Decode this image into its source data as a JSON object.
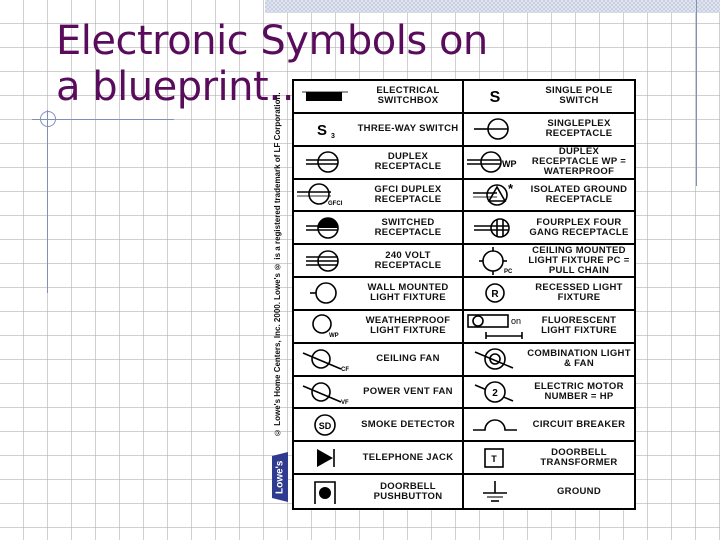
{
  "slide": {
    "title": "Electronic Symbols on a blueprint….",
    "copyright": "© Lowe's Home Centers, Inc. 2000. Lowe's ® is a registered trademark of LF Corporation.",
    "logo_text": "Lowe's",
    "colors": {
      "title": "#5a0c5c",
      "accent_line": "#8090b8",
      "logo": "#2e3b8f"
    }
  },
  "table": {
    "rows": [
      {
        "left": {
          "icon": "electrical-switchbox-icon",
          "label": "ELECTRICAL SWITCHBOX"
        },
        "right": {
          "icon": "single-pole-switch-icon",
          "symbol_text": "S",
          "label": "SINGLE POLE SWITCH"
        }
      },
      {
        "left": {
          "icon": "three-way-switch-icon",
          "symbol_text": "S",
          "symbol_sub": "3",
          "label": "THREE-WAY SWITCH"
        },
        "right": {
          "icon": "singleplex-receptacle-icon",
          "label": "SINGLEPLEX RECEPTACLE"
        }
      },
      {
        "left": {
          "icon": "duplex-receptacle-icon",
          "label": "DUPLEX RECEPTACLE"
        },
        "right": {
          "icon": "duplex-receptacle-waterproof-icon",
          "symbol_text": "WP",
          "label": "DUPLEX RECEPTACLE WP = WATERPROOF"
        }
      },
      {
        "left": {
          "icon": "gfci-duplex-receptacle-icon",
          "symbol_text": "GFCI",
          "label": "GFCI DUPLEX RECEPTACLE"
        },
        "right": {
          "icon": "isolated-ground-receptacle-icon",
          "symbol_text": "*",
          "label": "ISOLATED GROUND RECEPTACLE"
        }
      },
      {
        "left": {
          "icon": "switched-receptacle-icon",
          "label": "SWITCHED RECEPTACLE"
        },
        "right": {
          "icon": "fourplex-receptacle-icon",
          "label": "FOURPLEX FOUR GANG RECEPTACLE"
        }
      },
      {
        "left": {
          "icon": "240-volt-receptacle-icon",
          "label": "240 VOLT RECEPTACLE"
        },
        "right": {
          "icon": "ceiling-mounted-light-icon",
          "symbol_text": "PC",
          "label": "CEILING MOUNTED LIGHT FIXTURE PC = PULL CHAIN"
        }
      },
      {
        "left": {
          "icon": "wall-mounted-light-icon",
          "label": "WALL MOUNTED LIGHT FIXTURE"
        },
        "right": {
          "icon": "recessed-light-icon",
          "symbol_text": "R",
          "label": "RECESSED LIGHT FIXTURE"
        }
      },
      {
        "left": {
          "icon": "weatherproof-light-icon",
          "symbol_text": "WP",
          "label": "WEATHERPROOF LIGHT FIXTURE"
        },
        "right": {
          "icon": "fluorescent-light-icon",
          "symbol_text": "on",
          "label": "FLUORESCENT LIGHT FIXTURE"
        }
      },
      {
        "left": {
          "icon": "ceiling-fan-icon",
          "symbol_text": "CF",
          "label": "CEILING FAN"
        },
        "right": {
          "icon": "combination-light-fan-icon",
          "label": "COMBINATION LIGHT & FAN"
        }
      },
      {
        "left": {
          "icon": "power-vent-fan-icon",
          "symbol_text": "VF",
          "label": "POWER VENT FAN"
        },
        "right": {
          "icon": "electric-motor-icon",
          "symbol_text": "2",
          "label": "ELECTRIC MOTOR NUMBER = HP"
        }
      },
      {
        "left": {
          "icon": "smoke-detector-icon",
          "symbol_text": "SD",
          "label": "SMOKE DETECTOR"
        },
        "right": {
          "icon": "circuit-breaker-icon",
          "label": "CIRCUIT BREAKER"
        }
      },
      {
        "left": {
          "icon": "telephone-jack-icon",
          "label": "TELEPHONE JACK"
        },
        "right": {
          "icon": "doorbell-transformer-icon",
          "symbol_text": "T",
          "label": "DOORBELL TRANSFORMER"
        }
      },
      {
        "left": {
          "icon": "doorbell-pushbutton-icon",
          "label": "DOORBELL PUSHBUTTON"
        },
        "right": {
          "icon": "ground-icon",
          "label": "GROUND"
        }
      }
    ]
  }
}
